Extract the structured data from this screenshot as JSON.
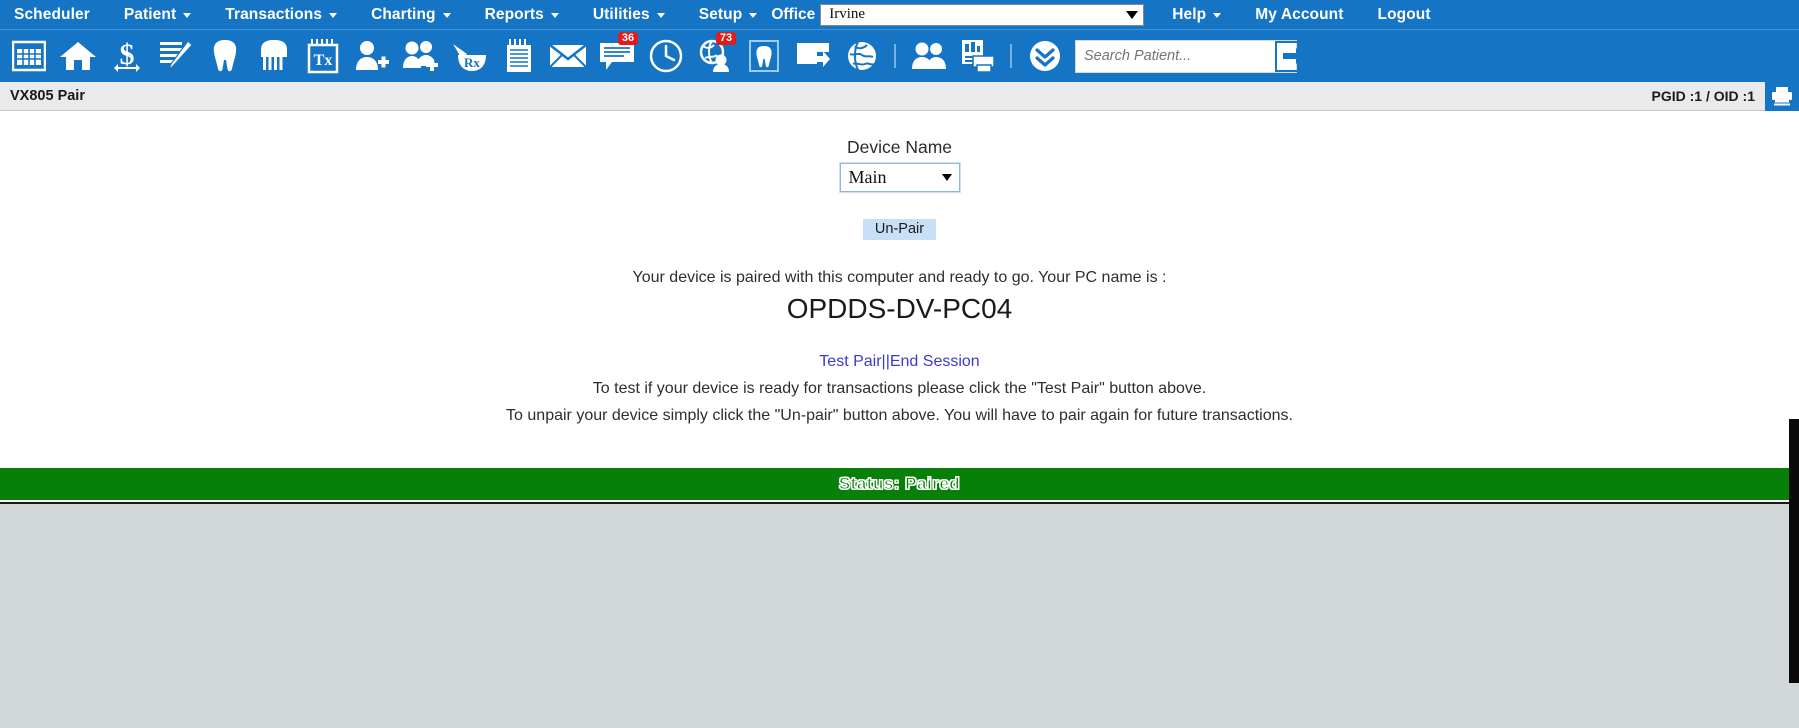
{
  "menubar": {
    "items": [
      {
        "label": "Scheduler",
        "has_caret": false
      },
      {
        "label": "Patient",
        "has_caret": true
      },
      {
        "label": "Transactions",
        "has_caret": true
      },
      {
        "label": "Charting",
        "has_caret": true
      },
      {
        "label": "Reports",
        "has_caret": true
      },
      {
        "label": "Utilities",
        "has_caret": true
      },
      {
        "label": "Setup",
        "has_caret": true
      }
    ],
    "office_label": "Office",
    "office_value": "Irvine",
    "right_items": [
      {
        "label": "Help",
        "has_caret": true
      },
      {
        "label": "My Account",
        "has_caret": false
      },
      {
        "label": "Logout",
        "has_caret": false
      }
    ]
  },
  "toolbar": {
    "icons": [
      {
        "name": "calendar-grid-icon",
        "badge": null
      },
      {
        "name": "home-icon",
        "badge": null
      },
      {
        "name": "dollar-ledger-icon",
        "badge": null
      },
      {
        "name": "notes-pencil-icon",
        "badge": null
      },
      {
        "name": "tooth-icon",
        "badge": null
      },
      {
        "name": "perio-tooth-icon",
        "badge": null
      },
      {
        "name": "treatment-plan-tx-icon",
        "badge": null
      },
      {
        "name": "add-patient-icon",
        "badge": null
      },
      {
        "name": "add-family-icon",
        "badge": null
      },
      {
        "name": "prescription-rx-icon",
        "badge": null
      },
      {
        "name": "clipboard-notes-icon",
        "badge": null
      },
      {
        "name": "mail-envelope-icon",
        "badge": null
      },
      {
        "name": "messages-chat-icon",
        "badge": "36"
      },
      {
        "name": "clock-icon",
        "badge": null
      },
      {
        "name": "patient-globe-icon",
        "badge": "73"
      },
      {
        "name": "tooth-chart-icon",
        "badge": null
      },
      {
        "name": "screen-forward-icon",
        "badge": null
      },
      {
        "name": "globe-icon",
        "badge": null
      },
      {
        "name": "separator",
        "badge": null
      },
      {
        "name": "users-group-icon",
        "badge": null
      },
      {
        "name": "print-reports-icon",
        "badge": null
      },
      {
        "name": "separator",
        "badge": null
      },
      {
        "name": "double-chevron-down-icon",
        "badge": null
      }
    ],
    "search_placeholder": "Search Patient...",
    "search_value": "",
    "search_go_icon": "arrow-right-icon"
  },
  "titlebar": {
    "title": "VX805 Pair",
    "pgid_oid": "PGID :1  /  OID :1",
    "printer_icon": "printer-icon"
  },
  "content": {
    "device_name_label": "Device Name",
    "device_name_value": "Main",
    "unpair_button": "Un-Pair",
    "paired_message": "Your device is paired with this computer and ready to go. Your PC name is :",
    "pc_name": "OPDDS-DV-PC04",
    "test_pair_link": "Test Pair",
    "link_separator": "||",
    "end_session_link": "End Session",
    "help_line_1": "To test if your device is ready for transactions please click the \"Test Pair\" button above.",
    "help_line_2": "To unpair your device simply click the \"Un-pair\" button above. You will have to pair again for future transactions."
  },
  "statusbar": {
    "text": "Status: Paired"
  },
  "colors": {
    "brand_blue": "#1574c4",
    "status_green": "#087f08",
    "badge_red": "#e21b1b",
    "link_blue": "#3a3ad0",
    "button_light_blue": "#c8e0f5"
  }
}
